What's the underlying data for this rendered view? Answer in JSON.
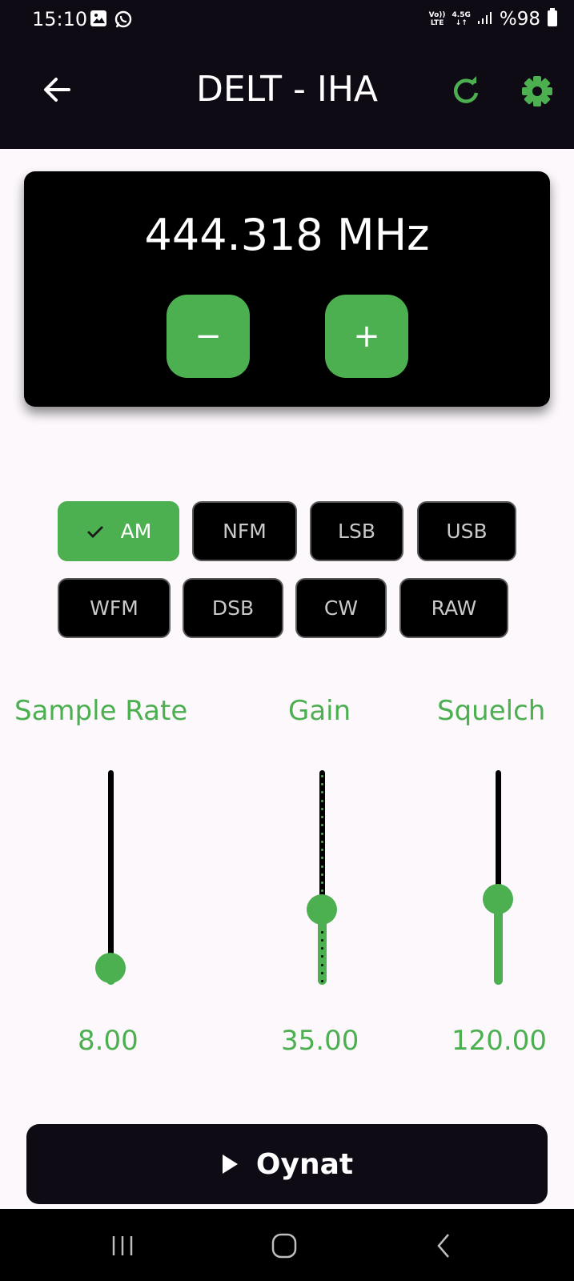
{
  "status_bar": {
    "time": "15:10",
    "network": "4.5G",
    "volte_line1": "Vo))",
    "volte_line2": "LTE",
    "battery": "%98"
  },
  "app_bar": {
    "title": "DELT - IHA"
  },
  "frequency": {
    "display": "444.318 MHz",
    "minus_label": "−",
    "plus_label": "+"
  },
  "modes": {
    "selected": "AM",
    "row1": [
      "AM",
      "NFM",
      "LSB",
      "USB"
    ],
    "row2": [
      "WFM",
      "DSB",
      "CW",
      "RAW"
    ]
  },
  "sliders": [
    {
      "label": "Sample Rate",
      "value": "8.00",
      "fraction": 0.08,
      "ticks": false
    },
    {
      "label": "Gain",
      "value": "35.00",
      "fraction": 0.35,
      "ticks": true
    },
    {
      "label": "Squelch",
      "value": "120.00",
      "fraction": 0.4,
      "ticks": false
    }
  ],
  "play": {
    "label": "Oynat"
  },
  "colors": {
    "accent": "#4caf50",
    "dark": "#0f0b14",
    "background": "#fcf8fc"
  }
}
